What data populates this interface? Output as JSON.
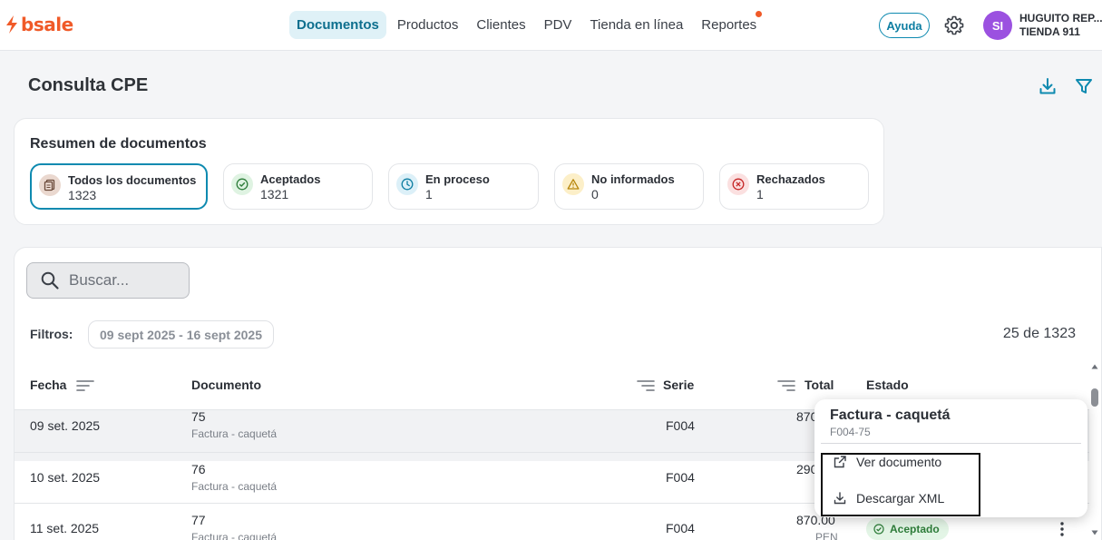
{
  "brand": {
    "name": "bsale",
    "color": "#f05a28"
  },
  "nav": {
    "items": [
      {
        "label": "Documentos",
        "active": true
      },
      {
        "label": "Productos"
      },
      {
        "label": "Clientes"
      },
      {
        "label": "PDV"
      },
      {
        "label": "Tienda en línea"
      },
      {
        "label": "Reportes",
        "has_notification": true
      }
    ],
    "help_label": "Ayuda",
    "avatar_initials": "SI",
    "user_name": "HUGUITO REP...",
    "user_store": "TIENDA 911"
  },
  "page": {
    "title": "Consulta CPE",
    "icons": [
      "download-icon",
      "filter-icon"
    ]
  },
  "summary": {
    "title": "Resumen de documentos",
    "stats": [
      {
        "label": "Todos los documentos",
        "value": "1323",
        "icon": "documents-icon",
        "selected": true
      },
      {
        "label": "Aceptados",
        "value": "1321",
        "icon": "check-circle-icon"
      },
      {
        "label": "En proceso",
        "value": "1",
        "icon": "clock-icon"
      },
      {
        "label": "No informados",
        "value": "0",
        "icon": "warning-icon"
      },
      {
        "label": "Rechazados",
        "value": "1",
        "icon": "x-circle-icon"
      }
    ]
  },
  "table": {
    "search_placeholder": "Buscar...",
    "filters_label": "Filtros:",
    "date_range": "09 sept 2025 - 16 sept 2025",
    "count": "25 de 1323",
    "columns": {
      "fecha": "Fecha",
      "documento": "Documento",
      "serie": "Serie",
      "total": "Total",
      "estado": "Estado"
    },
    "rows": [
      {
        "fecha": "09 set. 2025",
        "numero": "75",
        "tipo": "Factura - caquetá",
        "serie": "F004",
        "total": "870",
        "currency": ""
      },
      {
        "fecha": "10 set. 2025",
        "numero": "76",
        "tipo": "Factura - caquetá",
        "serie": "F004",
        "total": "290",
        "currency": ""
      },
      {
        "fecha": "11 set. 2025",
        "numero": "77",
        "tipo": "Factura - caquetá",
        "serie": "F004",
        "total": "870.00",
        "currency": "PEN",
        "estado": "Aceptado"
      }
    ]
  },
  "popover": {
    "title": "Factura - caquetá",
    "subtitle": "F004-75",
    "items": [
      {
        "label": "Ver documento",
        "icon": "external-link-icon"
      },
      {
        "label": "Descargar XML",
        "icon": "download-icon"
      }
    ]
  },
  "colors": {
    "accent": "#0e8ab0",
    "accepted_bg": "#e3f5e6",
    "accepted_text": "#2e7d3a"
  }
}
